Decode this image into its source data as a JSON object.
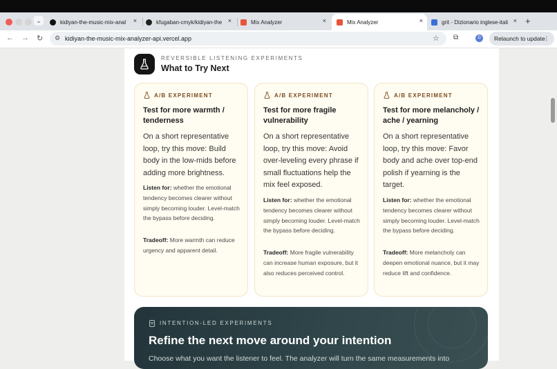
{
  "browser": {
    "tabs": [
      {
        "label": "kidiyan-the-music-mix-anal",
        "favicon_color": "#111111"
      },
      {
        "label": "kfugaban-cmyk/kidiyan-the",
        "favicon_color": "#222222"
      },
      {
        "label": "Mix Analyzer",
        "favicon_color": "#e8553b"
      },
      {
        "label": "Mix Analyzer",
        "favicon_color": "#e8553b",
        "active": true
      },
      {
        "label": "grit - Dizionario inglese-itali",
        "favicon_color": "#3b6fd8"
      }
    ],
    "close_glyph": "×",
    "new_tab_glyph": "+",
    "url": "kidiyan-the-music-mix-analyzer-api.vercel.app",
    "profile_initial": "D",
    "relaunch_label": "Relaunch to update"
  },
  "section": {
    "eyebrow": "REVERSIBLE LISTENING EXPERIMENTS",
    "title": "What to Try Next",
    "icon": "flask-icon"
  },
  "cards": [
    {
      "tag": "A/B EXPERIMENT",
      "title": "Test for more warmth / tenderness",
      "move": "On a short representative loop, try this move: Build body in the low-mids before adding more brightness.",
      "listen_label": "Listen for:",
      "listen_text": "whether the emotional tendency becomes clearer without simply becoming louder. Level-match the bypass before deciding.",
      "tradeoff_label": "Tradeoff:",
      "tradeoff_text": "More warmth can reduce urgency and apparent detail."
    },
    {
      "tag": "A/B EXPERIMENT",
      "title": "Test for more fragile vulnerability",
      "move": "On a short representative loop, try this move: Avoid over-leveling every phrase if small fluctuations help the mix feel exposed.",
      "listen_label": "Listen for:",
      "listen_text": "whether the emotional tendency becomes clearer without simply becoming louder. Level-match the bypass before deciding.",
      "tradeoff_label": "Tradeoff:",
      "tradeoff_text": "More fragile vulnerability can increase human exposure, but it also reduces perceived control."
    },
    {
      "tag": "A/B EXPERIMENT",
      "title": "Test for more melancholy / ache / yearning",
      "move": "On a short representative loop, try this move: Favor body and ache over top-end polish if yearning is the target.",
      "listen_label": "Listen for:",
      "listen_text": "whether the emotional tendency becomes clearer without simply becoming louder. Level-match the bypass before deciding.",
      "tradeoff_label": "Tradeoff:",
      "tradeoff_text": "More melancholy can deepen emotional nuance, but it may reduce lift and confidence."
    }
  ],
  "banner": {
    "eyebrow": "INTENTION-LED EXPERIMENTS",
    "title": "Refine the next move around your intention",
    "description": "Choose what you want the listener to feel. The analyzer will turn the same measurements into"
  },
  "colors": {
    "accent": "#7a4b1f",
    "card_bg": "#fffcf1",
    "card_border": "#f1e6c4",
    "banner_bg": "#2c4145"
  }
}
